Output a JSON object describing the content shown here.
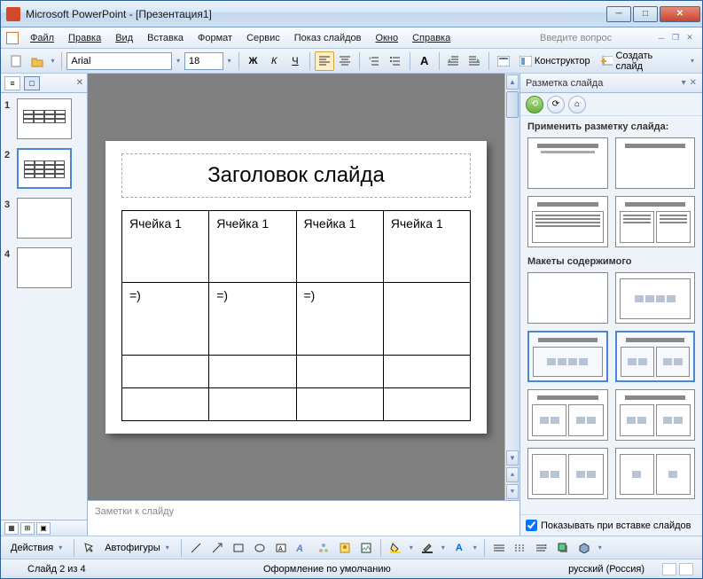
{
  "window": {
    "title": "Microsoft PowerPoint - [Презентация1]"
  },
  "menu": {
    "file": "Файл",
    "edit": "Правка",
    "view": "Вид",
    "insert": "Вставка",
    "format": "Формат",
    "tools": "Сервис",
    "slideshow": "Показ слайдов",
    "window": "Окно",
    "help": "Справка",
    "helpbox": "Введите вопрос"
  },
  "toolbar": {
    "font": "Arial",
    "size": "18",
    "designer": "Конструктор",
    "newslide": "Создать слайд"
  },
  "thumbs": {
    "items": [
      {
        "num": "1",
        "selected": false
      },
      {
        "num": "2",
        "selected": true
      },
      {
        "num": "3",
        "selected": false
      },
      {
        "num": "4",
        "selected": false
      }
    ]
  },
  "slide": {
    "title": "Заголовок слайда",
    "table": [
      [
        "Ячейка 1",
        "Ячейка 1",
        "Ячейка 1",
        "Ячейка 1"
      ],
      [
        "=)",
        "=)",
        "=)",
        ""
      ],
      [
        "",
        "",
        "",
        ""
      ],
      [
        "",
        "",
        "",
        ""
      ]
    ]
  },
  "notes": {
    "placeholder": "Заметки к слайду"
  },
  "taskpane": {
    "title": "Разметка слайда",
    "apply": "Применить разметку слайда:",
    "section2": "Макеты содержимого",
    "showcheck": "Показывать при вставке слайдов"
  },
  "drawbar": {
    "actions": "Действия",
    "autoshapes": "Автофигуры"
  },
  "status": {
    "slide": "Слайд 2 из 4",
    "design": "Оформление по умолчанию",
    "lang": "русский (Россия)"
  }
}
